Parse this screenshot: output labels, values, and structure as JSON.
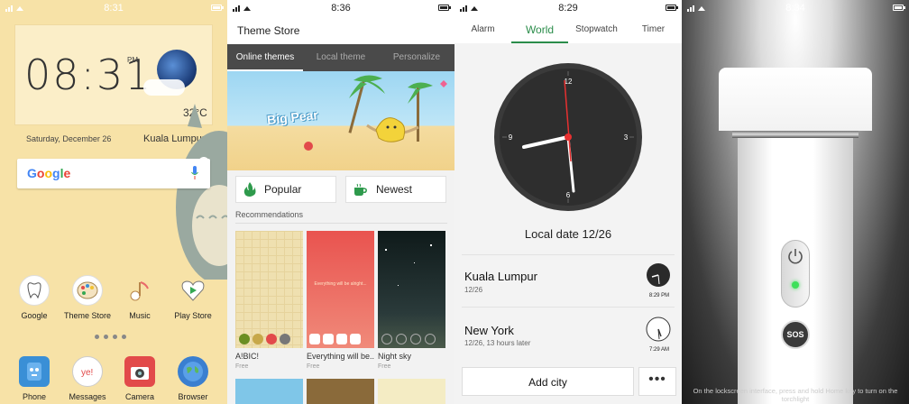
{
  "home": {
    "status_time": "8:31",
    "clock_time": "08:31",
    "clock_ampm": "PM",
    "temperature": "32°C",
    "date": "Saturday, December 26",
    "city": "Kuala Lumpur",
    "search_logo": "Google",
    "apps_row1": [
      {
        "label": "Google",
        "icon": "tooth-icon",
        "color": "#ffffff"
      },
      {
        "label": "Theme Store",
        "icon": "palette-icon",
        "color": "#ffffff"
      },
      {
        "label": "Music",
        "icon": "music-note-icon",
        "color": "#ffffff"
      },
      {
        "label": "Play Store",
        "icon": "play-heart-icon",
        "color": "#ffffff"
      }
    ],
    "apps_row2": [
      {
        "label": "Phone",
        "icon": "phone-robot-icon",
        "color": "#3a8fd6"
      },
      {
        "label": "Messages",
        "icon": "message-bubble-icon",
        "color": "#ffffff"
      },
      {
        "label": "Camera",
        "icon": "camera-icon",
        "color": "#e24a4a"
      },
      {
        "label": "Browser",
        "icon": "globe-icon",
        "color": "#3a7fd0"
      }
    ]
  },
  "theme_store": {
    "status_time": "8:36",
    "title": "Theme Store",
    "tabs": [
      "Online themes",
      "Local theme",
      "Personalize"
    ],
    "banner_title": "Big Pear",
    "popular_label": "Popular",
    "newest_label": "Newest",
    "recommendations_label": "Recommendations",
    "themes": [
      {
        "name": "A!BIC!",
        "price": "Free"
      },
      {
        "name": "Everything will be...",
        "price": "Free",
        "overlay": "Everything will be alright..."
      },
      {
        "name": "Night sky",
        "price": "Free"
      }
    ]
  },
  "clock": {
    "status_time": "8:29",
    "tabs": [
      "Alarm",
      "World",
      "Stopwatch",
      "Timer"
    ],
    "active_tab": "World",
    "dial_numbers": [
      "12",
      "3",
      "6",
      "9"
    ],
    "local_date": "Local date 12/26",
    "cities": [
      {
        "name": "Kuala Lumpur",
        "sub": "12/26",
        "time": "8:29 PM"
      },
      {
        "name": "New York",
        "sub": "12/26, 13 hours later",
        "time": "7:29 AM"
      }
    ],
    "add_city_label": "Add city",
    "more_label": "•••"
  },
  "flashlight": {
    "status_time": "8:34",
    "sos_label": "SOS",
    "hint": "On the lockscreen interface, press and hold Home key to turn on the torchlight"
  }
}
